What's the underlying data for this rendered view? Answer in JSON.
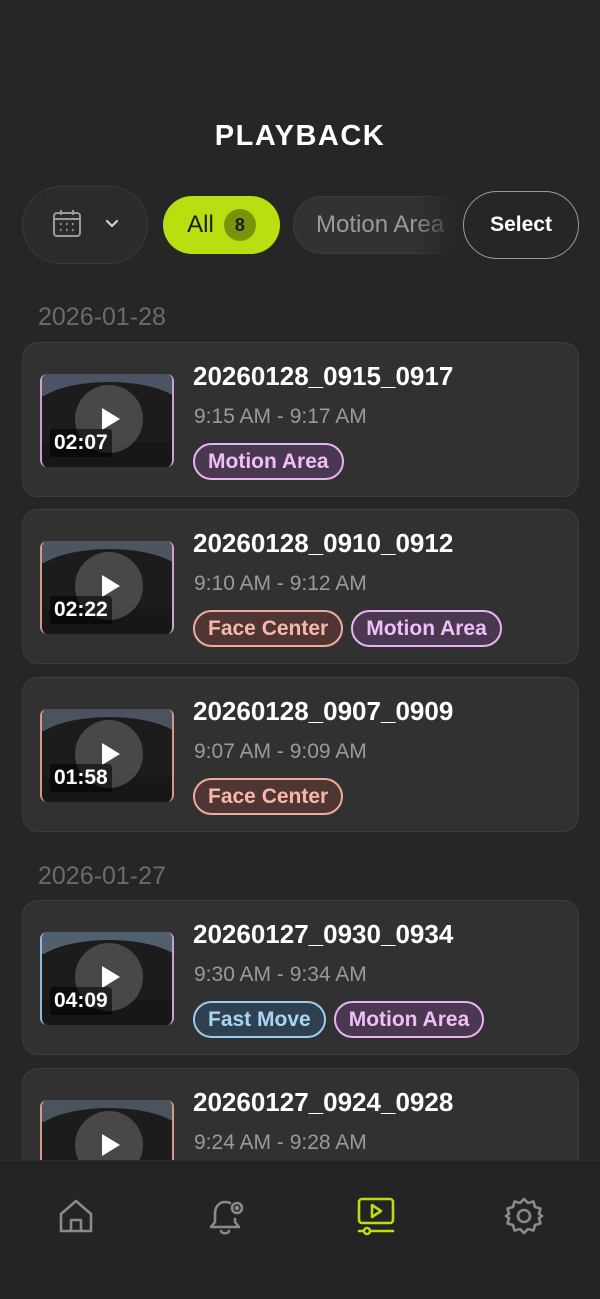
{
  "page": {
    "title": "PLAYBACK"
  },
  "filters": {
    "date_icon": "calendar-icon",
    "dropdown_icon": "chevron-down-icon",
    "all_label": "All",
    "all_count": "8",
    "motion_label": "Motion Area",
    "select_label": "Select"
  },
  "groups": [
    {
      "date": "2026-01-28"
    },
    {
      "date": "2026-01-27"
    }
  ],
  "recordings": [
    {
      "title": "20260128_0915_0917",
      "time": "9:15 AM - 9:17 AM",
      "duration": "02:07",
      "tags": [
        "Motion Area"
      ]
    },
    {
      "title": "20260128_0910_0912",
      "time": "9:10 AM - 9:12 AM",
      "duration": "02:22",
      "tags": [
        "Face Center",
        "Motion Area"
      ]
    },
    {
      "title": "20260128_0907_0909",
      "time": "9:07 AM - 9:09 AM",
      "duration": "01:58",
      "tags": [
        "Face Center"
      ]
    },
    {
      "title": "20260127_0930_0934",
      "time": "9:30 AM - 9:34 AM",
      "duration": "04:09",
      "tags": [
        "Fast Move",
        "Motion Area"
      ]
    },
    {
      "title": "20260127_0924_0928",
      "time": "9:24 AM - 9:28 AM",
      "duration": "",
      "tags": []
    }
  ],
  "colors": {
    "accent": "#b8df10",
    "motion_tag": "#e8b4f2",
    "face_tag": "#f0ac9c",
    "fast_tag": "#99cdf1"
  },
  "nav": {
    "items": [
      {
        "icon": "home-icon"
      },
      {
        "icon": "bell-alert-icon"
      },
      {
        "icon": "playback-icon",
        "active": true
      },
      {
        "icon": "gear-icon"
      }
    ]
  }
}
